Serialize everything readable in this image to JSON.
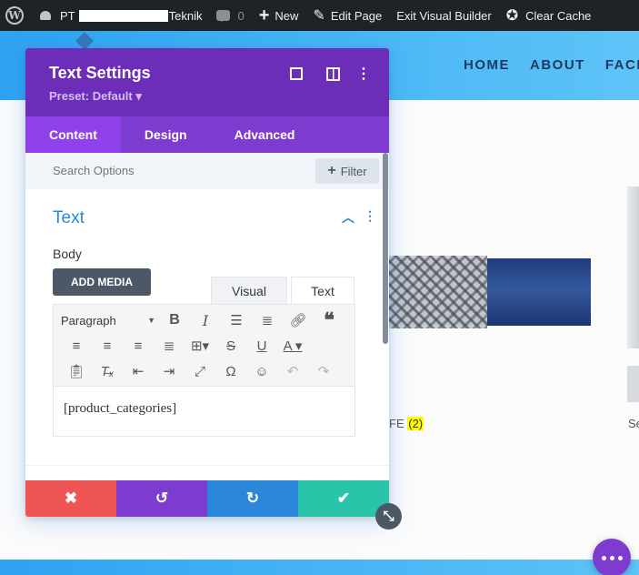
{
  "adminbar": {
    "site_prefix": "PT",
    "site_suffix": "Teknik",
    "comments_count": "0",
    "new_label": "New",
    "edit_page_label": "Edit Page",
    "exit_builder_label": "Exit Visual Builder",
    "clear_cache_label": "Clear Cache"
  },
  "site": {
    "nav": [
      "HOME",
      "ABOUT",
      "FACI"
    ],
    "product_label_prefix": "FE",
    "product_count": "(2)",
    "product_label2": "Se"
  },
  "modal": {
    "title": "Text Settings",
    "preset": "Preset: Default ▾",
    "tabs": [
      "Content",
      "Design",
      "Advanced"
    ],
    "search_placeholder": "Search Options",
    "filter_label": "Filter",
    "section_title": "Text",
    "body_label": "Body",
    "add_media_label": "ADD MEDIA",
    "editor_tabs": [
      "Visual",
      "Text"
    ],
    "format_select": "Paragraph",
    "editor_content": "[product_categories]"
  },
  "colors": {
    "modal_header": "#6c2eb9",
    "tabs_bar": "#7e3bd0",
    "cancel": "#ef5555",
    "undo": "#7e3bd0",
    "redo": "#2b87da",
    "save": "#29c4a9",
    "accent": "#2b87da"
  }
}
